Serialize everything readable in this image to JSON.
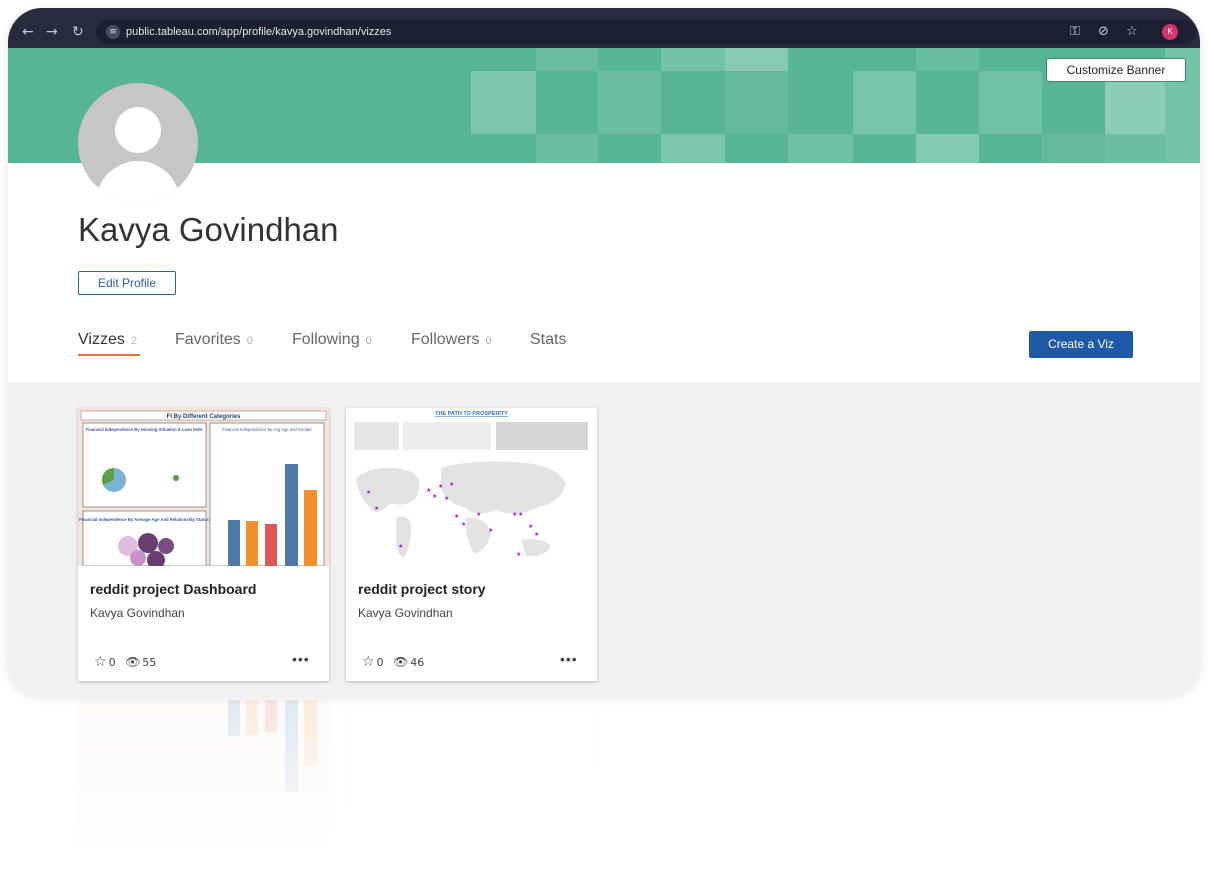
{
  "browser": {
    "url": "public.tableau.com/app/profile/kavya.govindhan/vizzes",
    "back_icon": "arrow-left-icon",
    "forward_icon": "arrow-right-icon",
    "reload_icon": "reload-icon",
    "profile_initial": "K"
  },
  "banner": {
    "customize_label": "Customize Banner",
    "color": "#57b595"
  },
  "profile": {
    "name": "Kavya Govindhan",
    "edit_label": "Edit Profile"
  },
  "tabs": [
    {
      "label": "Vizzes",
      "count": "2",
      "active": true
    },
    {
      "label": "Favorites",
      "count": "0",
      "active": false
    },
    {
      "label": "Following",
      "count": "0",
      "active": false
    },
    {
      "label": "Followers",
      "count": "0",
      "active": false
    },
    {
      "label": "Stats",
      "count": "",
      "active": false
    }
  ],
  "create_viz_label": "Create a Viz",
  "cards": [
    {
      "title": "reddit project Dashboard",
      "author": "Kavya Govindhan",
      "favorites": "0",
      "views": "55",
      "thumb": {
        "header": "FI By Different Categories",
        "panel1": "Financial Independence By Housing Situation & Loan Debt",
        "panel2": "Financial Independence by Avg Age and Gender",
        "panel3": "Financial Independence By Average Age And Relationship Status"
      }
    },
    {
      "title": "reddit project story",
      "author": "Kavya Govindhan",
      "favorites": "0",
      "views": "46",
      "thumb": {
        "header": "THE PATH TO PROSPERITY"
      }
    }
  ],
  "colors": {
    "accent_orange": "#e37335",
    "primary_blue": "#1f5aa6",
    "banner_green": "#57b595"
  }
}
